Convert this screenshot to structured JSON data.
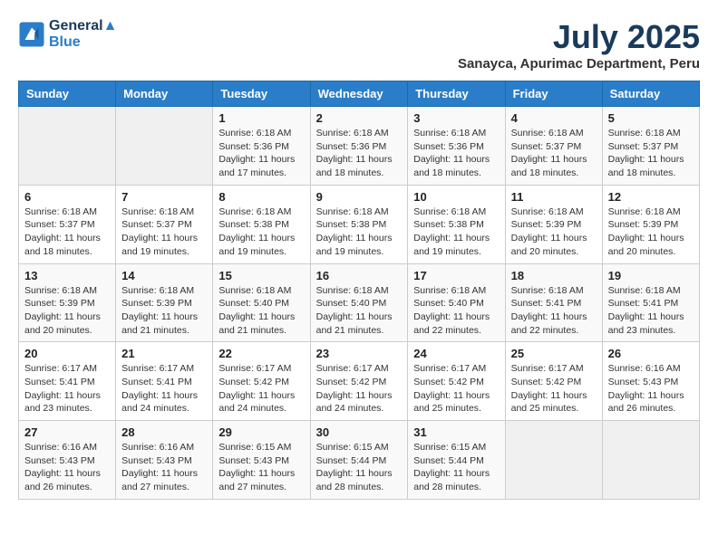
{
  "logo": {
    "line1": "General",
    "line2": "Blue"
  },
  "title": "July 2025",
  "subtitle": "Sanayca, Apurimac Department, Peru",
  "days_of_week": [
    "Sunday",
    "Monday",
    "Tuesday",
    "Wednesday",
    "Thursday",
    "Friday",
    "Saturday"
  ],
  "weeks": [
    [
      {
        "day": "",
        "content": ""
      },
      {
        "day": "",
        "content": ""
      },
      {
        "day": "1",
        "content": "Sunrise: 6:18 AM\nSunset: 5:36 PM\nDaylight: 11 hours and 17 minutes."
      },
      {
        "day": "2",
        "content": "Sunrise: 6:18 AM\nSunset: 5:36 PM\nDaylight: 11 hours and 18 minutes."
      },
      {
        "day": "3",
        "content": "Sunrise: 6:18 AM\nSunset: 5:36 PM\nDaylight: 11 hours and 18 minutes."
      },
      {
        "day": "4",
        "content": "Sunrise: 6:18 AM\nSunset: 5:37 PM\nDaylight: 11 hours and 18 minutes."
      },
      {
        "day": "5",
        "content": "Sunrise: 6:18 AM\nSunset: 5:37 PM\nDaylight: 11 hours and 18 minutes."
      }
    ],
    [
      {
        "day": "6",
        "content": "Sunrise: 6:18 AM\nSunset: 5:37 PM\nDaylight: 11 hours and 18 minutes."
      },
      {
        "day": "7",
        "content": "Sunrise: 6:18 AM\nSunset: 5:37 PM\nDaylight: 11 hours and 19 minutes."
      },
      {
        "day": "8",
        "content": "Sunrise: 6:18 AM\nSunset: 5:38 PM\nDaylight: 11 hours and 19 minutes."
      },
      {
        "day": "9",
        "content": "Sunrise: 6:18 AM\nSunset: 5:38 PM\nDaylight: 11 hours and 19 minutes."
      },
      {
        "day": "10",
        "content": "Sunrise: 6:18 AM\nSunset: 5:38 PM\nDaylight: 11 hours and 19 minutes."
      },
      {
        "day": "11",
        "content": "Sunrise: 6:18 AM\nSunset: 5:39 PM\nDaylight: 11 hours and 20 minutes."
      },
      {
        "day": "12",
        "content": "Sunrise: 6:18 AM\nSunset: 5:39 PM\nDaylight: 11 hours and 20 minutes."
      }
    ],
    [
      {
        "day": "13",
        "content": "Sunrise: 6:18 AM\nSunset: 5:39 PM\nDaylight: 11 hours and 20 minutes."
      },
      {
        "day": "14",
        "content": "Sunrise: 6:18 AM\nSunset: 5:39 PM\nDaylight: 11 hours and 21 minutes."
      },
      {
        "day": "15",
        "content": "Sunrise: 6:18 AM\nSunset: 5:40 PM\nDaylight: 11 hours and 21 minutes."
      },
      {
        "day": "16",
        "content": "Sunrise: 6:18 AM\nSunset: 5:40 PM\nDaylight: 11 hours and 21 minutes."
      },
      {
        "day": "17",
        "content": "Sunrise: 6:18 AM\nSunset: 5:40 PM\nDaylight: 11 hours and 22 minutes."
      },
      {
        "day": "18",
        "content": "Sunrise: 6:18 AM\nSunset: 5:41 PM\nDaylight: 11 hours and 22 minutes."
      },
      {
        "day": "19",
        "content": "Sunrise: 6:18 AM\nSunset: 5:41 PM\nDaylight: 11 hours and 23 minutes."
      }
    ],
    [
      {
        "day": "20",
        "content": "Sunrise: 6:17 AM\nSunset: 5:41 PM\nDaylight: 11 hours and 23 minutes."
      },
      {
        "day": "21",
        "content": "Sunrise: 6:17 AM\nSunset: 5:41 PM\nDaylight: 11 hours and 24 minutes."
      },
      {
        "day": "22",
        "content": "Sunrise: 6:17 AM\nSunset: 5:42 PM\nDaylight: 11 hours and 24 minutes."
      },
      {
        "day": "23",
        "content": "Sunrise: 6:17 AM\nSunset: 5:42 PM\nDaylight: 11 hours and 24 minutes."
      },
      {
        "day": "24",
        "content": "Sunrise: 6:17 AM\nSunset: 5:42 PM\nDaylight: 11 hours and 25 minutes."
      },
      {
        "day": "25",
        "content": "Sunrise: 6:17 AM\nSunset: 5:42 PM\nDaylight: 11 hours and 25 minutes."
      },
      {
        "day": "26",
        "content": "Sunrise: 6:16 AM\nSunset: 5:43 PM\nDaylight: 11 hours and 26 minutes."
      }
    ],
    [
      {
        "day": "27",
        "content": "Sunrise: 6:16 AM\nSunset: 5:43 PM\nDaylight: 11 hours and 26 minutes."
      },
      {
        "day": "28",
        "content": "Sunrise: 6:16 AM\nSunset: 5:43 PM\nDaylight: 11 hours and 27 minutes."
      },
      {
        "day": "29",
        "content": "Sunrise: 6:15 AM\nSunset: 5:43 PM\nDaylight: 11 hours and 27 minutes."
      },
      {
        "day": "30",
        "content": "Sunrise: 6:15 AM\nSunset: 5:44 PM\nDaylight: 11 hours and 28 minutes."
      },
      {
        "day": "31",
        "content": "Sunrise: 6:15 AM\nSunset: 5:44 PM\nDaylight: 11 hours and 28 minutes."
      },
      {
        "day": "",
        "content": ""
      },
      {
        "day": "",
        "content": ""
      }
    ]
  ]
}
